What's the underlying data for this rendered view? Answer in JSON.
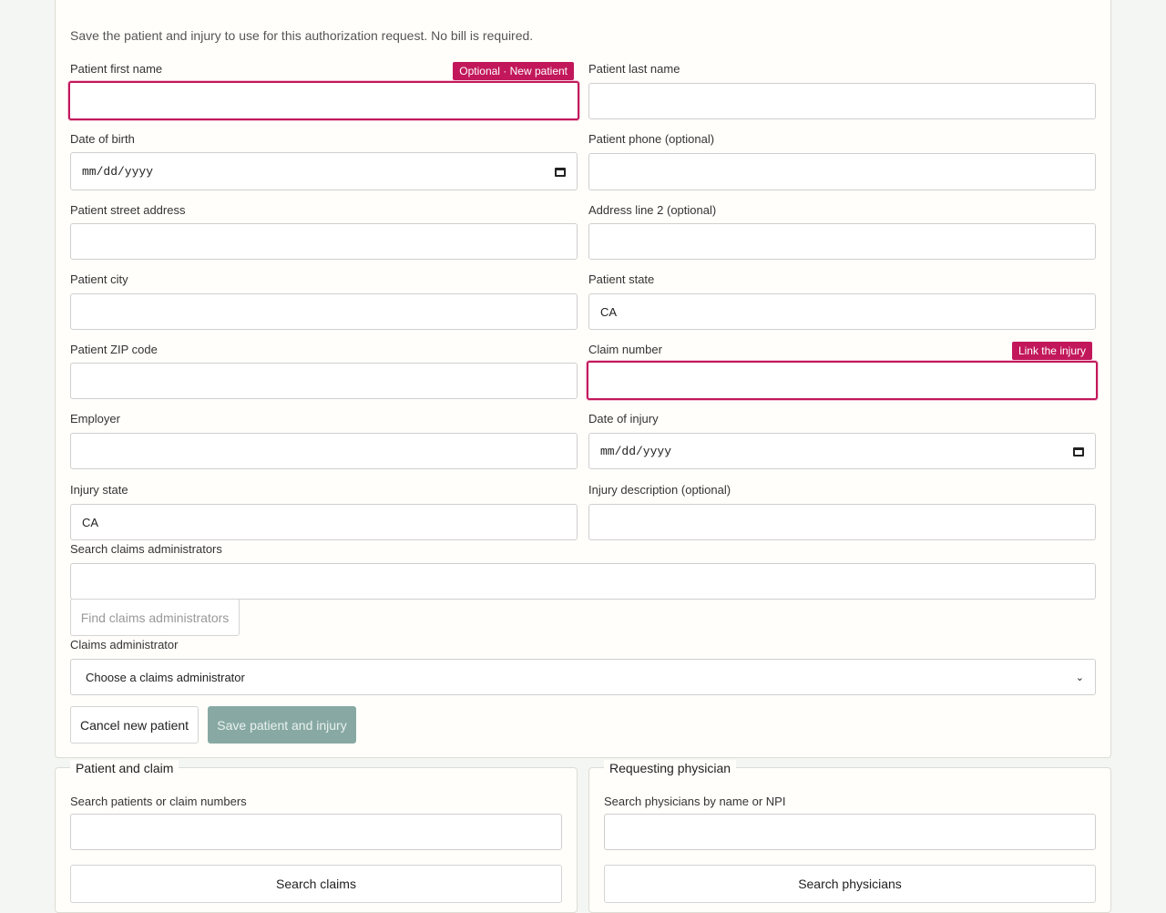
{
  "form": {
    "intro": "Save the patient and injury to use for this authorization request. No bill is required.",
    "first_name": {
      "label": "Patient first name",
      "value": "",
      "tag": "Optional · New patient"
    },
    "last_name": {
      "label": "Patient last name",
      "value": ""
    },
    "dob": {
      "label": "Date of birth",
      "placeholder": "mm/dd/yyyy"
    },
    "phone": {
      "label": "Patient phone (optional)",
      "value": ""
    },
    "street": {
      "label": "Patient street address",
      "value": ""
    },
    "address2": {
      "label": "Address line 2 (optional)",
      "value": ""
    },
    "city": {
      "label": "Patient city",
      "value": ""
    },
    "state": {
      "label": "Patient state",
      "value": "CA"
    },
    "zip": {
      "label": "Patient ZIP code",
      "value": ""
    },
    "claim_number": {
      "label": "Claim number",
      "value": "",
      "tag": "Link the injury"
    },
    "employer": {
      "label": "Employer",
      "value": ""
    },
    "date_of_injury": {
      "label": "Date of injury",
      "placeholder": "mm/dd/yyyy"
    },
    "injury_state": {
      "label": "Injury state",
      "value": "CA"
    },
    "injury_description": {
      "label": "Injury description (optional)",
      "value": ""
    },
    "search_admins": {
      "label": "Search claims administrators",
      "value": ""
    },
    "find_admins_button": "Find claims administrators",
    "claims_admin": {
      "label": "Claims administrator",
      "selected": "Choose a claims administrator"
    },
    "cancel_button": "Cancel new patient",
    "save_button": "Save patient and injury"
  },
  "patient_panel": {
    "legend": "Patient and claim",
    "search_label": "Search patients or claim numbers",
    "search_value": "",
    "search_button": "Search claims"
  },
  "physician_panel": {
    "legend": "Requesting physician",
    "search_label": "Search physicians by name or NPI",
    "search_value": "",
    "search_button": "Search physicians"
  },
  "colors": {
    "accent": "#c2185b",
    "save_disabled": "#88a9a3"
  },
  "icons": [
    "calendar-icon",
    "chevron-down-icon"
  ]
}
